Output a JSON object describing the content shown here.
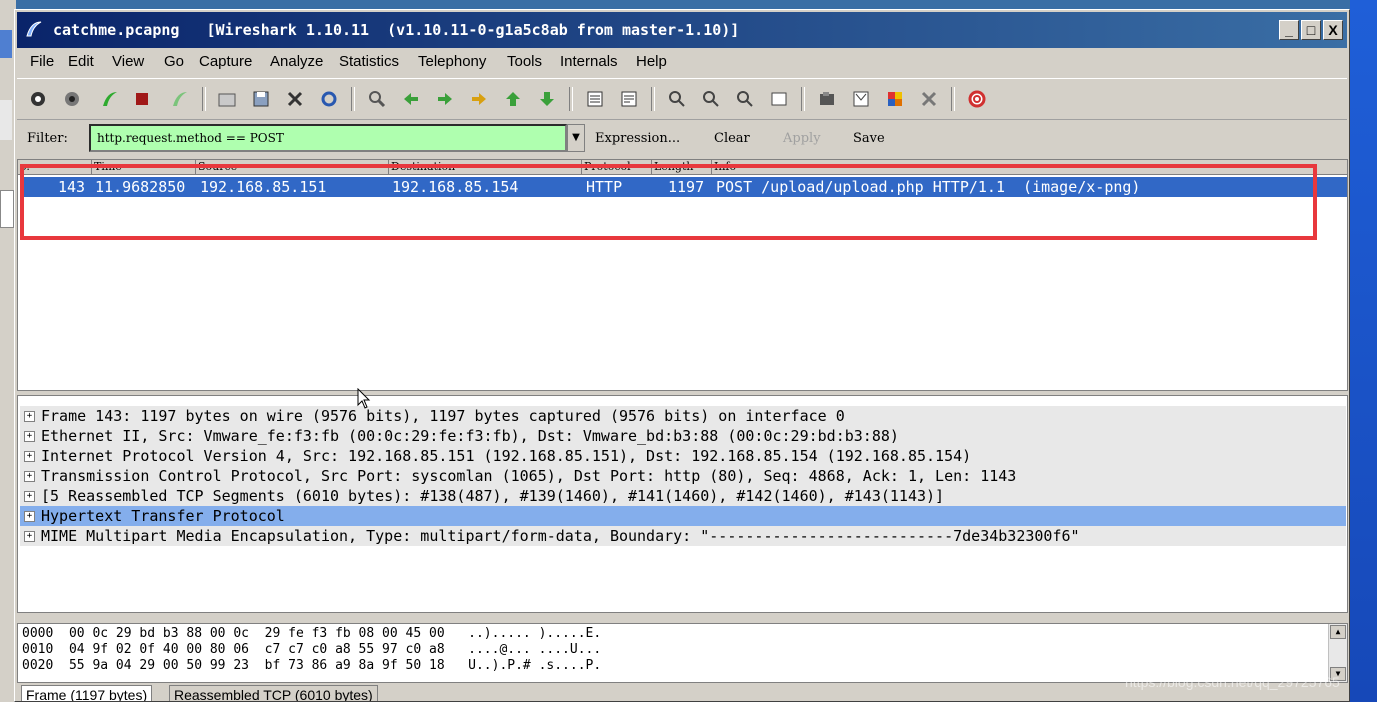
{
  "window": {
    "title": "catchme.pcapng   [Wireshark 1.10.11  (v1.10.11-0-g1a5c8ab from master-1.10)]",
    "controls": [
      "_",
      "□",
      "X"
    ]
  },
  "menu": [
    "File",
    "Edit",
    "View",
    "Go",
    "Capture",
    "Analyze",
    "Statistics",
    "Telephony",
    "Tools",
    "Internals",
    "Help"
  ],
  "filter": {
    "label": "Filter:",
    "value": "http.request.method == POST",
    "expression_label": "Expression...",
    "clear_label": "Clear",
    "apply_label": "Apply",
    "save_label": "Save"
  },
  "packet_list": {
    "columns": [
      "o.",
      "Time",
      "Source",
      "Destination",
      "Protocol",
      "Length",
      "Info"
    ],
    "rows": [
      {
        "no": "143",
        "time": "11.9682850",
        "source": "192.168.85.151",
        "destination": "192.168.85.154",
        "protocol": "HTTP",
        "length": "1197",
        "info": "POST /upload/upload.php HTTP/1.1  (image/x-png)"
      }
    ]
  },
  "details": [
    "Frame 143: 1197 bytes on wire (9576 bits), 1197 bytes captured (9576 bits) on interface 0",
    "Ethernet II, Src: Vmware_fe:f3:fb (00:0c:29:fe:f3:fb), Dst: Vmware_bd:b3:88 (00:0c:29:bd:b3:88)",
    "Internet Protocol Version 4, Src: 192.168.85.151 (192.168.85.151), Dst: 192.168.85.154 (192.168.85.154)",
    "Transmission Control Protocol, Src Port: syscomlan (1065), Dst Port: http (80), Seq: 4868, Ack: 1, Len: 1143",
    "[5 Reassembled TCP Segments (6010 bytes): #138(487), #139(1460), #141(1460), #142(1460), #143(1143)]",
    "Hypertext Transfer Protocol",
    "MIME Multipart Media Encapsulation, Type: multipart/form-data, Boundary: \"---------------------------7de34b32300f6\""
  ],
  "hex": [
    {
      "offset": "0000",
      "bytes": "00 0c 29 bd b3 88 00 0c  29 fe f3 fb 08 00 45 00",
      "ascii": "..)..... ).....E."
    },
    {
      "offset": "0010",
      "bytes": "04 9f 02 0f 40 00 80 06  c7 c7 c0 a8 55 97 c0 a8",
      "ascii": "....@... ....U..."
    },
    {
      "offset": "0020",
      "bytes": "55 9a 04 29 00 50 99 23  bf 73 86 a9 8a 9f 50 18",
      "ascii": "U..).P.# .s....P."
    }
  ],
  "bottom_tabs": [
    "Frame (1197 bytes)",
    "Reassembled TCP (6010 bytes)"
  ],
  "watermark": "https://blog.csdn.net/qq_29725765",
  "colors": {
    "selection": "#3168c6",
    "filter_ok": "#afffaf",
    "highlight_row": "#84aeec",
    "annotation": "#e8383d"
  }
}
